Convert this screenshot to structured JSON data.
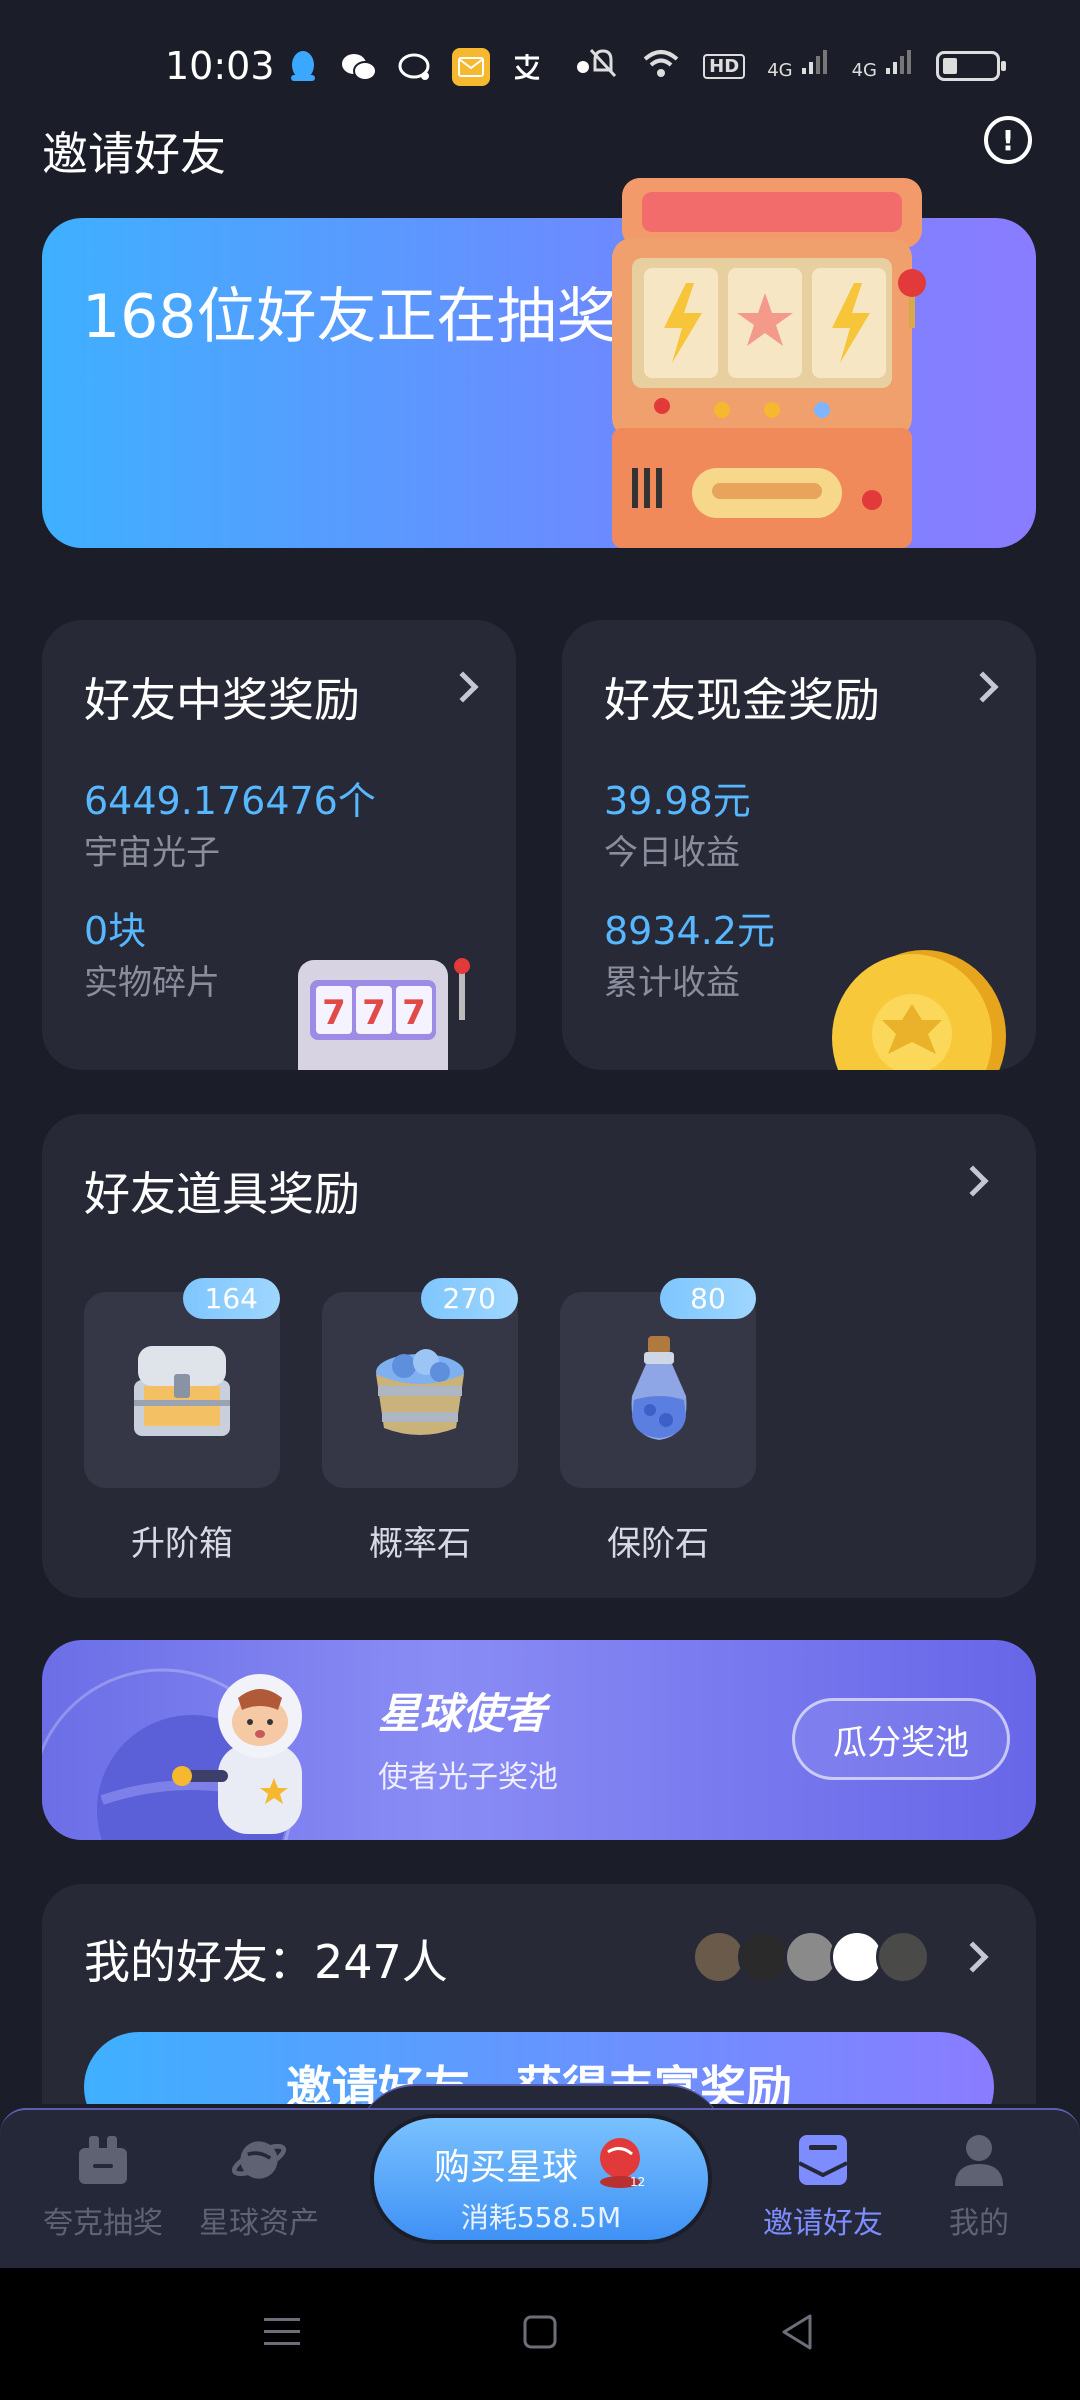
{
  "status_bar": {
    "time": "10:03",
    "network_badge": "HD",
    "signal_1": "4G",
    "signal_2": "4G"
  },
  "header": {
    "title": "邀请好友"
  },
  "banner": {
    "text": "168位好友正在抽奖"
  },
  "prize_reward": {
    "title": "好友中奖奖励",
    "value1": "6449.176476个",
    "label1": "宇宙光子",
    "value2": "0块",
    "label2": "实物碎片"
  },
  "cash_reward": {
    "title": "好友现金奖励",
    "value1": "39.98元",
    "label1": "今日收益",
    "value2": "8934.2元",
    "label2": "累计收益"
  },
  "item_reward": {
    "title": "好友道具奖励",
    "items": [
      {
        "count": "164",
        "name": "升阶箱"
      },
      {
        "count": "270",
        "name": "概率石"
      },
      {
        "count": "80",
        "name": "保阶石"
      }
    ]
  },
  "ambassador": {
    "title": "星球使者",
    "subtitle": "使者光子奖池",
    "button": "瓜分奖池"
  },
  "friends": {
    "title": "我的好友：247人",
    "invite_button": "邀请好友，获得丰富奖励"
  },
  "bottom_nav": {
    "items": [
      {
        "label": "夸克抽奖"
      },
      {
        "label": "星球资产"
      },
      {
        "label": "邀请好友"
      },
      {
        "label": "我的"
      }
    ],
    "center": {
      "label": "购买星球",
      "sub": "消耗558.5M",
      "badge": "12"
    }
  },
  "colors": {
    "background": "#1b1d29",
    "card": "#272937",
    "accent_blue": "#57b7ff",
    "active_nav": "#7d8cff"
  }
}
